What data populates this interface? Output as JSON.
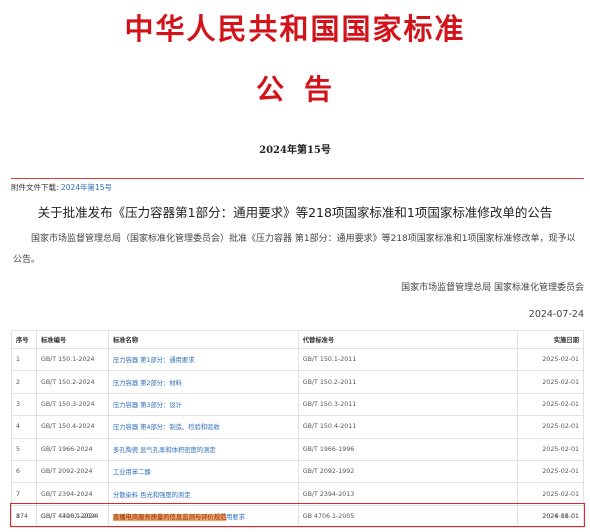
{
  "header": {
    "title": "中华人民共和国国家标准",
    "subtitle": "公告",
    "issue": "2024年第15号"
  },
  "attachment": {
    "label": "附件文件下载:",
    "link": "2024年第15号"
  },
  "announcement": {
    "headline": "关于批准发布《压力容器第1部分：通用要求》等218项国家标准和1项国家标准修改单的公告",
    "body": "国家市场监督管理总局（国家标准化管理委员会）批准《压力容器 第1部分：通用要求》等218项国家标准和1项国家标准修改单，现予以公告。",
    "signer": "国家市场监督管理总局 国家标准化管理委员会",
    "date": "2024-07-24"
  },
  "table": {
    "headers": [
      "序号",
      "标准编号",
      "标准名称",
      "代替标准号",
      "实施日期"
    ],
    "rows": [
      [
        "1",
        "GB/T 150.1-2024",
        "压力容器 第1部分：通用要求",
        "GB/T 150.1-2011",
        "2025-02-01"
      ],
      [
        "2",
        "GB/T 150.2-2024",
        "压力容器 第2部分：材料",
        "GB/T 150.2-2011",
        "2025-02-01"
      ],
      [
        "3",
        "GB/T 150.3-2024",
        "压力容器 第3部分：设计",
        "GB/T 150.3-2011",
        "2025-02-01"
      ],
      [
        "4",
        "GB/T 150.4-2024",
        "压力容器 第4部分：制造、检验和验收",
        "GB/T 150.4-2011",
        "2025-02-01"
      ],
      [
        "5",
        "GB/T 1966-2024",
        "多孔陶瓷 显气孔率和体积密度的测定",
        "GB/T 1966-1996",
        "2025-02-01"
      ],
      [
        "6",
        "GB/T 2092-2024",
        "工业用苯二酸",
        "GB/T 2092-1992",
        "2025-02-01"
      ],
      [
        "7",
        "GB/T 2394-2024",
        "分散染料 色光和强度的测定",
        "GB/T 2394-2013",
        "2025-02-01"
      ],
      [
        "8",
        "GB/T 4706.1-2024",
        "家用和类似用途电器的安全 第1部分：通用要求",
        "GB 4706.1-2005",
        "2026-08-01"
      ]
    ],
    "last_row": [
      "174",
      "GB/T 44207-2024",
      "直播电商服务质量的信息监测与评价规范",
      "",
      "2024-11-01"
    ]
  }
}
